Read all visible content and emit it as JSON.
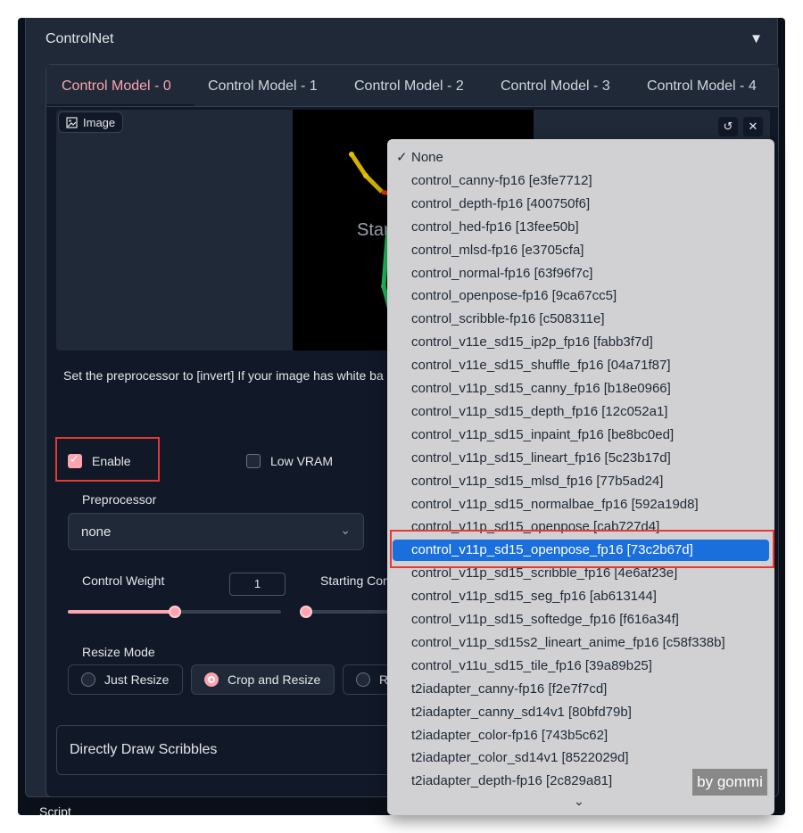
{
  "accordion": {
    "title": "ControlNet",
    "toggle_icon": "▼"
  },
  "tabs": [
    {
      "label": "Control Model - 0"
    },
    {
      "label": "Control Model - 1"
    },
    {
      "label": "Control Model - 2"
    },
    {
      "label": "Control Model - 3"
    },
    {
      "label": "Control Model - 4"
    }
  ],
  "image": {
    "label": "Image",
    "canvas_text": "Start",
    "reset_icon": "↺",
    "close_icon": "✕"
  },
  "hint": "Set the preprocessor to [invert] If your image has white ba",
  "enable": {
    "label": "Enable",
    "checked": true
  },
  "low_vram": {
    "label": "Low VRAM",
    "checked": false
  },
  "preprocessor": {
    "label": "Preprocessor",
    "value": "none",
    "chevron": "⌄"
  },
  "control_weight": {
    "label": "Control Weight",
    "value": "1",
    "fill": 0.5
  },
  "starting_control": {
    "label": "Starting Cont",
    "fill": 0
  },
  "resize_mode": {
    "label": "Resize Mode",
    "options": [
      {
        "label": "Just Resize"
      },
      {
        "label": "Crop and Resize"
      },
      {
        "label": "Res"
      }
    ],
    "selected": "Crop and Resize"
  },
  "scribbles": {
    "title": "Directly Draw Scribbles"
  },
  "script_label": "Script",
  "dropdown": {
    "check_mark": "✓",
    "scroll_icon": "⌄",
    "items": [
      "None",
      "control_canny-fp16 [e3fe7712]",
      "control_depth-fp16 [400750f6]",
      "control_hed-fp16 [13fee50b]",
      "control_mlsd-fp16 [e3705cfa]",
      "control_normal-fp16 [63f96f7c]",
      "control_openpose-fp16 [9ca67cc5]",
      "control_scribble-fp16 [c508311e]",
      "control_v11e_sd15_ip2p_fp16 [fabb3f7d]",
      "control_v11e_sd15_shuffle_fp16 [04a71f87]",
      "control_v11p_sd15_canny_fp16 [b18e0966]",
      "control_v11p_sd15_depth_fp16 [12c052a1]",
      "control_v11p_sd15_inpaint_fp16 [be8bc0ed]",
      "control_v11p_sd15_lineart_fp16 [5c23b17d]",
      "control_v11p_sd15_mlsd_fp16 [77b5ad24]",
      "control_v11p_sd15_normalbae_fp16 [592a19d8]",
      "control_v11p_sd15_openpose [cab727d4]",
      "control_v11p_sd15_openpose_fp16 [73c2b67d]",
      "control_v11p_sd15_scribble_fp16 [4e6af23e]",
      "control_v11p_sd15_seg_fp16 [ab613144]",
      "control_v11p_sd15_softedge_fp16 [f616a34f]",
      "control_v11p_sd15s2_lineart_anime_fp16 [c58f338b]",
      "control_v11u_sd15_tile_fp16 [39a89b25]",
      "t2iadapter_canny-fp16 [f2e7f7cd]",
      "t2iadapter_canny_sd14v1 [80bfd79b]",
      "t2iadapter_color-fp16 [743b5c62]",
      "t2iadapter_color_sd14v1 [8522029d]",
      "t2iadapter_depth-fp16 [2c829a81]"
    ],
    "checked_item": "None",
    "highlighted_item": "control_v11p_sd15_openpose_fp16 [73c2b67d]"
  },
  "watermark": "by gommi",
  "colors": {
    "accent": "#fda4af",
    "highlight": "#1a6fdc",
    "annotation_red": "#e53935",
    "panel_bg": "#111827"
  }
}
